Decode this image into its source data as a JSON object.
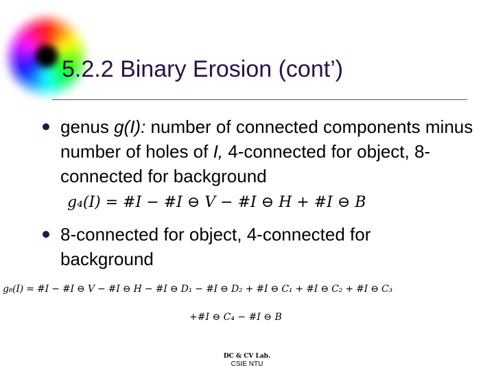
{
  "title": "5.2.2 Binary Erosion (cont’)",
  "bullets": [
    {
      "pre": "genus ",
      "italic": "g(I):",
      "mid": " number of connected components minus number of holes of ",
      "italic2": "I,",
      "post": " 4-connected for object, 8-connected for background"
    },
    {
      "text": "8-connected for object, 4-connected for background"
    }
  ],
  "formulas": {
    "g4": "g₄(I) = #I − #I ⊖ V − #I ⊖ H + #I ⊖ B",
    "g8_line1": "g₈(I) = #I − #I ⊖ V − #I ⊖ H − #I ⊖ D₁ − #I ⊖ D₂ + #I ⊖ C₁ + #I ⊖ C₂ + #I ⊖ C₃",
    "g8_line2": "+#I ⊖ C₄ − #I ⊖ B"
  },
  "footer": {
    "lab": "DC & CV Lab.",
    "org": "CSIE NTU"
  },
  "colors": {
    "title": "#2a1248",
    "bullet": "#2a1248"
  }
}
